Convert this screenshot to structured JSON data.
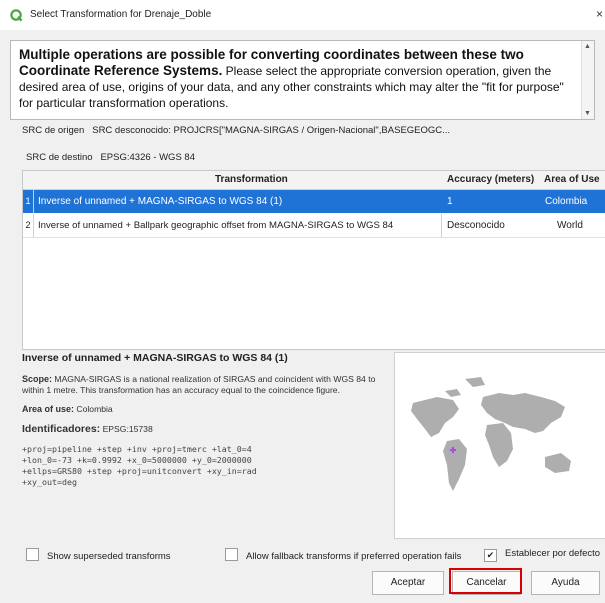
{
  "window": {
    "title": "Select Transformation for Drenaje_Doble",
    "close_glyph": "×"
  },
  "message": {
    "bold": "Multiple operations are possible for converting coordinates between these two Coordinate Reference Systems.",
    "normal": " Please select the appropriate conversion operation, given the desired area of use, origins of your data, and any other constraints which may alter the \"fit for purpose\" for particular transformation operations."
  },
  "source_crs": {
    "label": "SRC de origen",
    "value": "SRC desconocido: PROJCRS[\"MAGNA-SIRGAS / Origen-Nacional\",BASEGEOGC..."
  },
  "dest_crs": {
    "label": "SRC de destino",
    "value": "EPSG:4326 - WGS 84"
  },
  "table": {
    "columns": [
      "Transformation",
      "Accuracy (meters)",
      "Area of Use"
    ],
    "rows": [
      {
        "num": "1",
        "transformation": "Inverse of unnamed + MAGNA-SIRGAS to WGS 84 (1)",
        "accuracy": "1",
        "area": "Colombia"
      },
      {
        "num": "2",
        "transformation": "Inverse of unnamed + Ballpark geographic offset from MAGNA-SIRGAS to WGS 84",
        "accuracy": "Desconocido",
        "area": "World"
      }
    ]
  },
  "details": {
    "title": "Inverse of unnamed + MAGNA-SIRGAS to WGS 84 (1)",
    "scope_label": "Scope:",
    "scope_text": "MAGNA-SIRGAS is a national realization of SIRGAS and coincident with WGS 84 to within 1 metre. This transformation has an accuracy equal to the coincidence figure.",
    "area_label": "Area of use:",
    "area_value": "Colombia",
    "ids_label": "Identificadores:",
    "ids_value": "EPSG:15738",
    "proj": "+proj=pipeline +step +inv +proj=tmerc +lat_0=4\n+lon_0=-73 +k=0.9992 +x_0=5000000 +y_0=2000000\n+ellps=GRS80 +step +proj=unitconvert +xy_in=rad\n+xy_out=deg"
  },
  "options": {
    "show_superseded": "Show superseded transforms",
    "allow_fallback": "Allow fallback transforms if preferred operation fails",
    "set_default": "Establecer por defecto",
    "set_default_checked": "✔"
  },
  "buttons": {
    "accept": "Aceptar",
    "cancel": "Cancelar",
    "help": "Ayuda"
  },
  "colors": {
    "selection": "#1f73d6",
    "highlight": "#d80000",
    "qgis_green": "#4ba543",
    "marker": "#a64ce0"
  }
}
